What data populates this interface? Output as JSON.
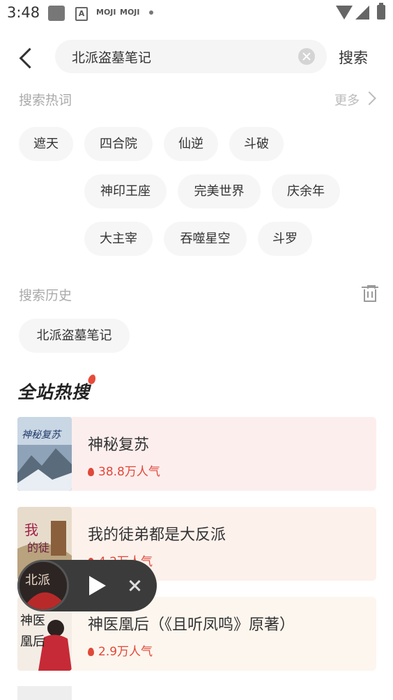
{
  "status_bar": {
    "time": "3:48",
    "icons": [
      "gallery-icon",
      "a-icon",
      "moji-icon",
      "moji-icon",
      "dot-icon",
      "wifi-icon",
      "signal-icon",
      "battery-icon"
    ],
    "moji_label": "MOJI"
  },
  "header": {
    "search_value": "北派盗墓笔记",
    "search_button": "搜索"
  },
  "hot_words": {
    "title": "搜索热词",
    "more": "更多",
    "tags": [
      "遮天",
      "四合院",
      "仙逆",
      "斗破",
      "神印王座",
      "完美世界",
      "庆余年",
      "大主宰",
      "吞噬星空",
      "斗罗"
    ]
  },
  "history": {
    "title": "搜索历史",
    "tags": [
      "北派盗墓笔记"
    ]
  },
  "hot_search": {
    "title": "全站热搜",
    "items": [
      {
        "name": "神秘复苏",
        "popularity": "38.8万人气",
        "bg": "#fdeeee"
      },
      {
        "name": "我的徒弟都是大反派",
        "popularity": "4.2万人气",
        "bg": "#fdf1ec"
      },
      {
        "name": "神医凰后（《且听凤鸣》原著）",
        "popularity": "2.9万人气",
        "bg": "#fdf6ee"
      }
    ]
  },
  "colors": {
    "accent": "#e04838",
    "tag_bg": "#f6f6f6",
    "player_bg": "#3b3b3b"
  }
}
